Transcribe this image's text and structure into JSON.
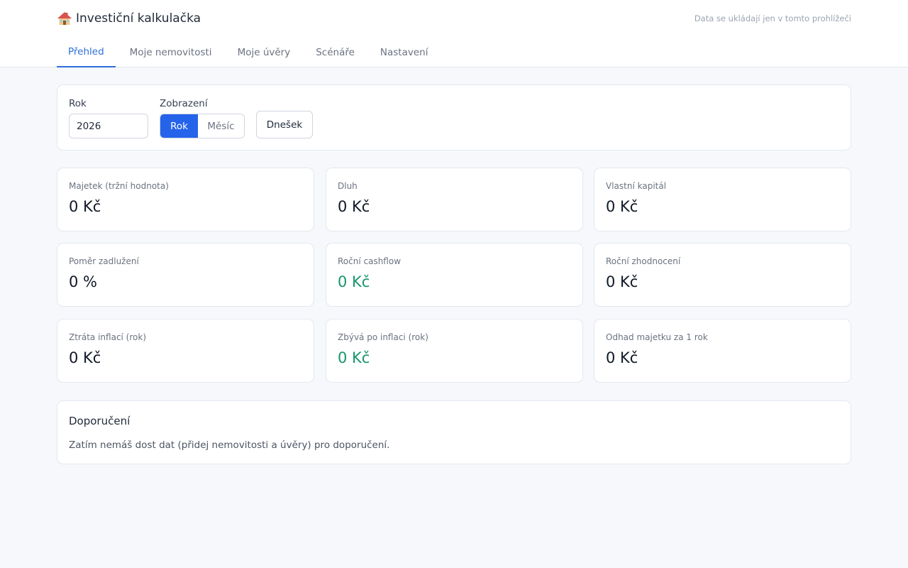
{
  "header": {
    "title": "Investiční kalkulačka",
    "title_icon": "house-icon",
    "privacy_note": "Data se ukládají jen v tomto prohlížeči"
  },
  "tabs": [
    {
      "label": "Přehled",
      "active": true
    },
    {
      "label": "Moje nemovitosti",
      "active": false
    },
    {
      "label": "Moje úvěry",
      "active": false
    },
    {
      "label": "Scénáře",
      "active": false
    },
    {
      "label": "Nastavení",
      "active": false
    }
  ],
  "filters": {
    "year_label": "Rok",
    "year_value": "2026",
    "view_label": "Zobrazení",
    "view_options": [
      "Rok",
      "Měsíc"
    ],
    "view_selected": "Rok",
    "today_button": "Dnešek"
  },
  "metrics": [
    {
      "label": "Majetek (tržní hodnota)",
      "value": "0 Kč"
    },
    {
      "label": "Dluh",
      "value": "0 Kč"
    },
    {
      "label": "Vlastní kapitál",
      "value": "0 Kč"
    },
    {
      "label": "Poměr zadlužení",
      "value": "0 %"
    },
    {
      "label": "Roční cashflow",
      "value": "0 Kč",
      "tone": "positive"
    },
    {
      "label": "Roční zhodnocení",
      "value": "0 Kč"
    },
    {
      "label": "Ztráta inflací (rok)",
      "value": "0 Kč"
    },
    {
      "label": "Zbývá po inflaci (rok)",
      "value": "0 Kč",
      "tone": "positive"
    },
    {
      "label": "Odhad majetku za 1 rok",
      "value": "0 Kč"
    }
  ],
  "recommendations": {
    "title": "Doporučení",
    "text": "Zatím nemáš dost dat (přidej nemovitosti a úvěry) pro doporučení."
  },
  "colors": {
    "accent": "#2563eb",
    "tab_active": "#2f6fdb",
    "positive": "#17966b",
    "background": "#f6f8fb"
  }
}
